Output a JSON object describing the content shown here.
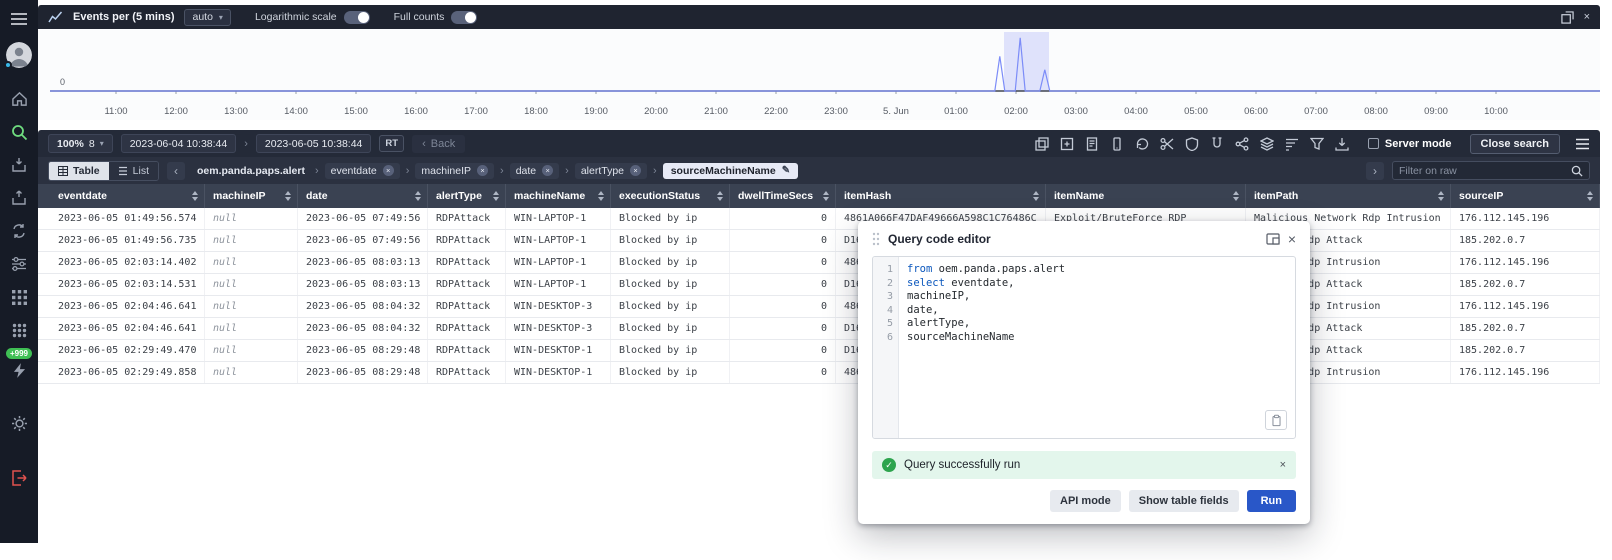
{
  "sidebar": {
    "notification_badge": "+999"
  },
  "chart_panel": {
    "title": "Events per (5 mins)",
    "interval_value": "auto",
    "log_scale_label": "Logarithmic scale",
    "full_counts_label": "Full counts"
  },
  "chart_data": {
    "type": "line",
    "title": "Events per (5 mins)",
    "x_ticks": [
      "11:00",
      "12:00",
      "13:00",
      "14:00",
      "15:00",
      "16:00",
      "17:00",
      "18:00",
      "19:00",
      "20:00",
      "21:00",
      "22:00",
      "23:00",
      "5. Jun",
      "01:00",
      "02:00",
      "03:00",
      "04:00",
      "05:00",
      "06:00",
      "07:00",
      "08:00",
      "09:00",
      "10:00"
    ],
    "y_min_label": "0",
    "baseline_value": 0,
    "spikes": [
      {
        "tick_pos": 14.73,
        "rel_height": 0.62
      },
      {
        "tick_pos": 15.07,
        "rel_height": 0.95
      },
      {
        "tick_pos": 15.48,
        "rel_height": 0.38
      }
    ],
    "selection_band": {
      "from_tick": 14.8,
      "to_tick": 15.55
    },
    "grid": false,
    "legend": false
  },
  "toolbar": {
    "zoom_value": "100%",
    "zoom_count": "8",
    "date_from": "2023-06-04 10:38:44",
    "date_to": "2023-06-05 10:38:44",
    "rt_badge": "RT",
    "back_label": "Back",
    "server_mode_label": "Server mode",
    "close_search_label": "Close search"
  },
  "filterbar": {
    "table_toggle": "Table",
    "list_toggle": "List",
    "source_chip": "oem.panda.paps.alert",
    "field_chips": [
      "eventdate",
      "machineIP",
      "date",
      "alertType"
    ],
    "active_chip": "sourceMachineName",
    "filter_input_placeholder": "Filter on raw"
  },
  "table": {
    "columns": [
      "eventdate",
      "machineIP",
      "date",
      "alertType",
      "machineName",
      "executionStatus",
      "dwellTimeSecs",
      "itemHash",
      "itemName",
      "itemPath",
      "sourceIP"
    ],
    "rows": [
      [
        "2023-06-05 01:49:56.574",
        "null",
        "2023-06-05 07:49:56",
        "RDPAttack",
        "WIN-LAPTOP-1",
        "Blocked by ip",
        "0",
        "4861A066F47DAF49666A598C1C76486C",
        "Exploit/BruteForce RDP",
        "Malicious Network Rdp Intrusion",
        "176.112.145.196"
      ],
      [
        "2023-06-05 01:49:56.735",
        "null",
        "2023-06-05 07:49:56",
        "RDPAttack",
        "WIN-LAPTOP-1",
        "Blocked by ip",
        "0",
        "D16",
        "",
        "Network Rdp Attack",
        "185.202.0.7"
      ],
      [
        "2023-06-05 02:03:14.402",
        "null",
        "2023-06-05 08:03:13",
        "RDPAttack",
        "WIN-LAPTOP-1",
        "Blocked by ip",
        "0",
        "486",
        "",
        "Network Rdp Intrusion",
        "176.112.145.196"
      ],
      [
        "2023-06-05 02:03:14.531",
        "null",
        "2023-06-05 08:03:13",
        "RDPAttack",
        "WIN-LAPTOP-1",
        "Blocked by ip",
        "0",
        "D16",
        "",
        "Network Rdp Attack",
        "185.202.0.7"
      ],
      [
        "2023-06-05 02:04:46.641",
        "null",
        "2023-06-05 08:04:32",
        "RDPAttack",
        "WIN-DESKTOP-3",
        "Blocked by ip",
        "0",
        "486",
        "",
        "Network Rdp Intrusion",
        "176.112.145.196"
      ],
      [
        "2023-06-05 02:04:46.641",
        "null",
        "2023-06-05 08:04:32",
        "RDPAttack",
        "WIN-DESKTOP-3",
        "Blocked by ip",
        "0",
        "D16",
        "",
        "Network Rdp Attack",
        "185.202.0.7"
      ],
      [
        "2023-06-05 02:29:49.470",
        "null",
        "2023-06-05 08:29:48",
        "RDPAttack",
        "WIN-DESKTOP-1",
        "Blocked by ip",
        "0",
        "D16",
        "",
        "Network Rdp Attack",
        "185.202.0.7"
      ],
      [
        "2023-06-05 02:29:49.858",
        "null",
        "2023-06-05 08:29:48",
        "RDPAttack",
        "WIN-DESKTOP-1",
        "Blocked by ip",
        "0",
        "486",
        "",
        "Network Rdp Intrusion",
        "176.112.145.196"
      ]
    ]
  },
  "dialog": {
    "title": "Query code editor",
    "code_lines": [
      {
        "num": "1",
        "keyword": "from",
        "text": "oem.panda.paps.alert"
      },
      {
        "num": "2",
        "keyword": "select",
        "text": "eventdate,"
      },
      {
        "num": "3",
        "keyword": "",
        "text": "machineIP,"
      },
      {
        "num": "4",
        "keyword": "",
        "text": "date,"
      },
      {
        "num": "5",
        "keyword": "",
        "text": "alertType,"
      },
      {
        "num": "6",
        "keyword": "",
        "text": "sourceMachineName"
      }
    ],
    "success_message": "Query successfully run",
    "api_mode_label": "API mode",
    "show_fields_label": "Show table fields",
    "run_label": "Run"
  },
  "colors": {
    "accent_green": "#6fdc7f",
    "success_bg": "#e3f6ec",
    "run_button": "#2957c8",
    "spike_line": "#7c8cf8",
    "selection_band": "#dfe2fb",
    "logout_red": "#e0524e"
  }
}
